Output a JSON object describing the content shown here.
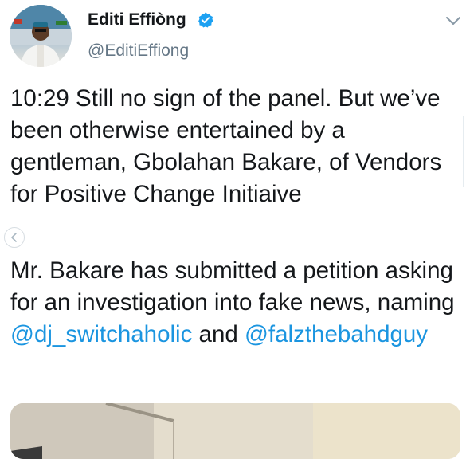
{
  "author": {
    "name": "Editi Effiòng",
    "handle": "@EditiEffiong",
    "verified": true
  },
  "tweet": {
    "paragraph1": "10:29 Still no sign of the panel. But we’ve been otherwise entertained by a gentleman, Gbolahan Bakare, of Vendors for Positive Change Initiaive",
    "paragraph2_text": "Mr. Bakare has submitted a petition asking for an investigation into fake news, naming ",
    "mention1": "@dj_switchaholic",
    "connector": " and ",
    "mention2": "@falzthebahdguy"
  },
  "colors": {
    "link": "#1b95e0",
    "verified_badge": "#1da1f2",
    "handle_gray": "#657786"
  },
  "icons": [
    "verified-badge-icon",
    "chevron-down-icon",
    "chevron-left-icon"
  ]
}
